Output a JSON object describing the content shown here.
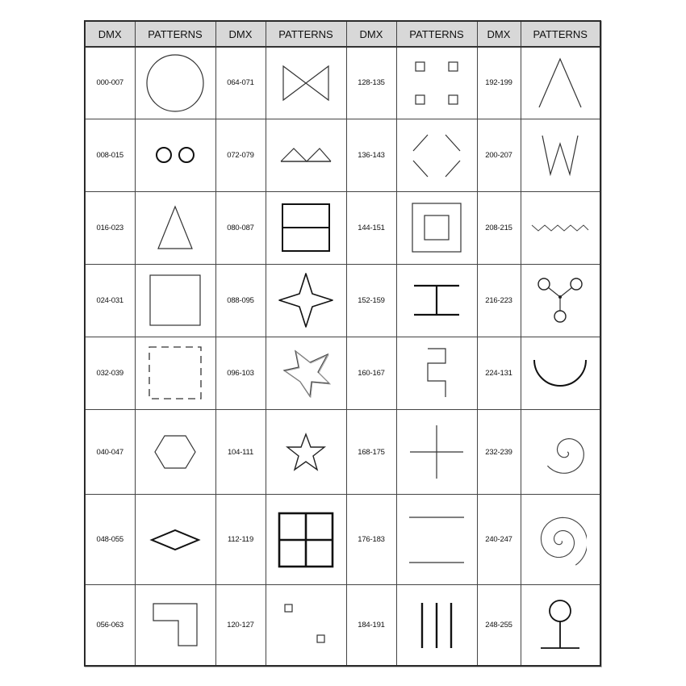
{
  "headers": [
    "DMX",
    "PATTERNS",
    "DMX",
    "PATTERNS",
    "DMX",
    "PATTERNS",
    "DMX",
    "PATTERNS"
  ],
  "rows": [
    {
      "cells": [
        {
          "dmx": "000-007",
          "pattern": "circle"
        },
        {
          "dmx": "064-071",
          "pattern": "bowtie"
        },
        {
          "dmx": "128-135",
          "pattern": "four-small-squares"
        },
        {
          "dmx": "192-199",
          "pattern": "inverted-v"
        }
      ]
    },
    {
      "cells": [
        {
          "dmx": "008-015",
          "pattern": "two-circles"
        },
        {
          "dmx": "072-079",
          "pattern": "double-peak"
        },
        {
          "dmx": "136-143",
          "pattern": "diamond-corner-brackets"
        },
        {
          "dmx": "200-207",
          "pattern": "w-shape"
        }
      ]
    },
    {
      "cells": [
        {
          "dmx": "016-023",
          "pattern": "triangle"
        },
        {
          "dmx": "080-087",
          "pattern": "split-square"
        },
        {
          "dmx": "144-151",
          "pattern": "nested-squares"
        },
        {
          "dmx": "208-215",
          "pattern": "zigzag"
        }
      ]
    },
    {
      "cells": [
        {
          "dmx": "024-031",
          "pattern": "square"
        },
        {
          "dmx": "088-095",
          "pattern": "four-point-star"
        },
        {
          "dmx": "152-159",
          "pattern": "i-beam"
        },
        {
          "dmx": "216-223",
          "pattern": "y-three-circles"
        }
      ]
    },
    {
      "cells": [
        {
          "dmx": "032-039",
          "pattern": "dashed-square"
        },
        {
          "dmx": "096-103",
          "pattern": "pinwheel-star"
        },
        {
          "dmx": "160-167",
          "pattern": "s-serpentine"
        },
        {
          "dmx": "224-131",
          "pattern": "u-arc"
        }
      ]
    },
    {
      "cells": [
        {
          "dmx": "040-047",
          "pattern": "hexagon"
        },
        {
          "dmx": "104-111",
          "pattern": "five-point-star"
        },
        {
          "dmx": "168-175",
          "pattern": "cross"
        },
        {
          "dmx": "232-239",
          "pattern": "small-spiral"
        }
      ]
    },
    {
      "cells": [
        {
          "dmx": "048-055",
          "pattern": "rhombus"
        },
        {
          "dmx": "112-119",
          "pattern": "window-grid"
        },
        {
          "dmx": "176-183",
          "pattern": "two-horizontal-lines"
        },
        {
          "dmx": "240-247",
          "pattern": "large-spiral"
        }
      ]
    },
    {
      "cells": [
        {
          "dmx": "056-063",
          "pattern": "l-shape"
        },
        {
          "dmx": "120-127",
          "pattern": "two-tiny-squares"
        },
        {
          "dmx": "184-191",
          "pattern": "three-vertical-lines"
        },
        {
          "dmx": "248-255",
          "pattern": "circle-on-stand"
        }
      ]
    }
  ]
}
